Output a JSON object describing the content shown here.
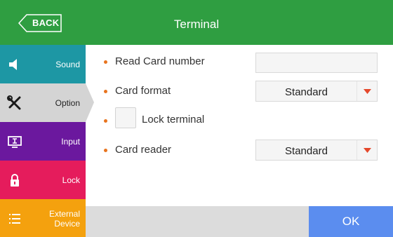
{
  "header": {
    "title": "Terminal",
    "back_label": "BACK",
    "background": "#2f9e41"
  },
  "sidebar": {
    "items": [
      {
        "label": "Sound",
        "icon": "speaker-icon",
        "color": "#1d97a4",
        "active": false
      },
      {
        "label": "Option",
        "icon": "tools-icon",
        "color": "#d4d4d4",
        "active": true
      },
      {
        "label": "Input",
        "icon": "monitor-icon",
        "color": "#6b189e",
        "active": false
      },
      {
        "label": "Lock",
        "icon": "lock-icon",
        "color": "#e51c5c",
        "active": false
      },
      {
        "label": "External Device",
        "icon": "list-icon",
        "color": "#f4a10e",
        "active": false
      }
    ]
  },
  "form": {
    "read_card_number": {
      "label": "Read Card number",
      "value": ""
    },
    "card_format": {
      "label": "Card format",
      "value": "Standard"
    },
    "lock_terminal": {
      "label": "Lock terminal",
      "checked": false
    },
    "card_reader": {
      "label": "Card reader",
      "value": "Standard"
    },
    "bullet_color": "#e8741e",
    "dropdown_arrow_color": "#e5482b"
  },
  "footer": {
    "ok_label": "OK",
    "ok_color": "#5b8def"
  }
}
